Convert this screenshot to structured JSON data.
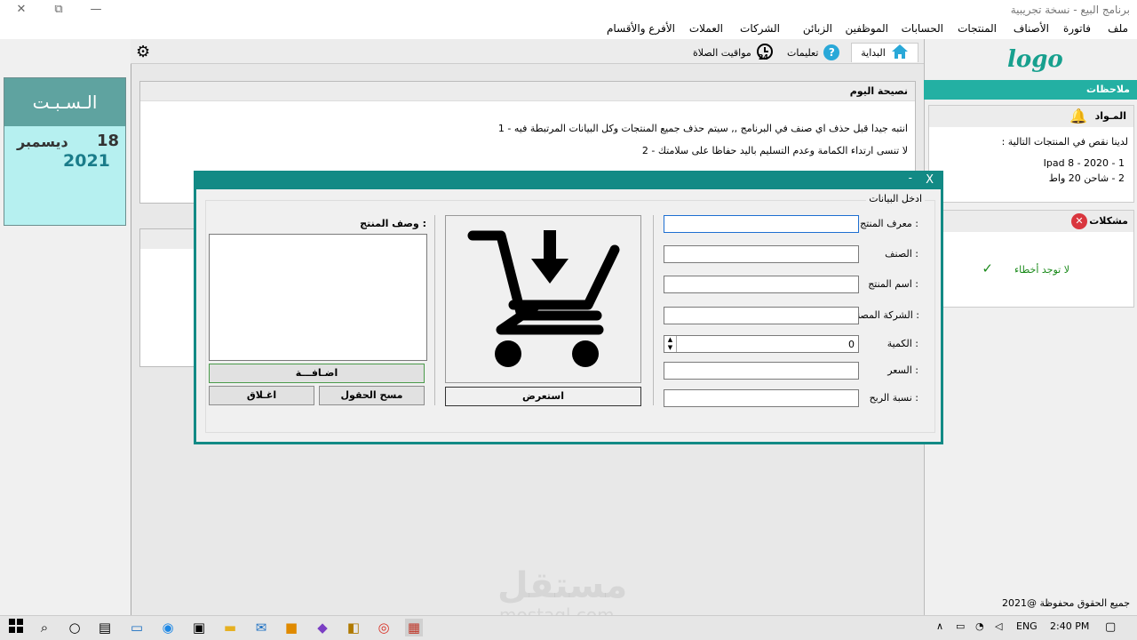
{
  "window": {
    "title": "برنامج البيع - نسخة تجريبية",
    "close": "✕",
    "maximize": "⧉",
    "minimize": "—"
  },
  "menu": [
    "ملف",
    "فاتورة",
    "الأصناف",
    "المنتجات",
    "الحسابات",
    "الموظفين",
    "الزبائن",
    "الشركات",
    "العملات",
    "الأفرع والأقسام"
  ],
  "date": {
    "day": "الـسـبـت",
    "daynum": "18",
    "month": "ديسمبر",
    "year": "2021"
  },
  "tabs": {
    "home": "البداية",
    "help": "تعليمات",
    "prayer": "مواقيت الصلاة",
    "help_icon": "?"
  },
  "tip": {
    "title": "نصيحة اليوم",
    "line1": "1 - انتبه جيدا قبل حذف اي صنف في البرنامج ,, سيتم حذف جميع المنتجات وكل البيانات المرتبطة فيه",
    "line2": "2 - لا تنسى ارتداء الكمامة وعدم التسليم باليد حفاظا على سلامتك"
  },
  "right": {
    "logo": "logo",
    "notes": "ملاحظات",
    "materials_title": "المـواد",
    "materials_intro": "لدينا نقص في المنتجات التالية :",
    "materials_1": "Ipad 8 - 2020 - 1",
    "materials_2": "2 - شاحن 20 واط",
    "problems_title": "مشكلات",
    "no_errors": "لا توجد أخطاء",
    "copyright": "جميع الحقوق محفوظة @2021"
  },
  "dialog": {
    "minimize": "-",
    "close": "X",
    "group_label": "ادخل البيانات",
    "fields": {
      "id_label": "معرف المنتج :",
      "category_label": "الصنف :",
      "name_label": "اسم المنتج :",
      "company_label": "الشركة المصنعة :",
      "quantity_label": "الكمية :",
      "price_label": "السعر :",
      "profit_label": "نسبة الربح :",
      "quantity_value": "0"
    },
    "browse": "استعرض",
    "desc_label": "وصف المنتج :",
    "add": "اضـافـــة",
    "clear": "مسح الحقول",
    "close_btn": "اغـلاق"
  },
  "watermark": {
    "ar": "مستقل",
    "en": "mostaql.com"
  },
  "taskbar": {
    "lang": "ENG",
    "time": "2:40 PM"
  },
  "colors": {
    "teal": "#128a85",
    "accent": "#23b0a3",
    "logo": "#17a08e"
  }
}
